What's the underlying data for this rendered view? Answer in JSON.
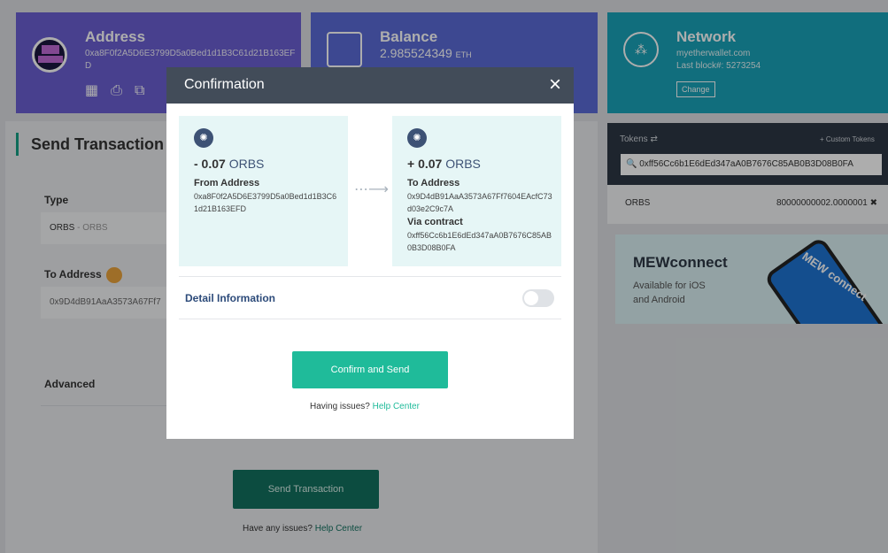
{
  "header": {
    "address": {
      "title": "Address",
      "value": "0xa8F0f2A5D6E3799D5a0Bed1d1B3C61d21B163EFD",
      "icons": [
        "qr-code-icon",
        "print-icon",
        "copy-icon"
      ]
    },
    "balance": {
      "title": "Balance",
      "value": "2.985524349",
      "unit": "ETH"
    },
    "network": {
      "title": "Network",
      "node": "myetherwallet.com",
      "last_block": "Last block#: 5273254",
      "change_label": "Change"
    }
  },
  "send": {
    "title": "Send Transaction",
    "type_label": "Type",
    "type_value": "ORBS",
    "type_value_sub": " - ORBS",
    "to_label": "To Address",
    "to_value": "0x9D4dB91AaA3573A67Ff7",
    "advanced_label": "Advanced",
    "send_button": "Send Transaction",
    "issues_text": "Have any issues?",
    "help_link": "Help Center"
  },
  "sidebar": {
    "tokens_label": "Tokens ⇄",
    "custom_tokens": "+ Custom Tokens",
    "search_value": "0xff56Cc6b1E6dEd347aA0B7676C85AB0B3D08B0FA",
    "token_name": "ORBS",
    "token_value": "80000000002.0000001",
    "mewconnect_title": "MEWconnect",
    "mewconnect_sub1": "Available for iOS",
    "mewconnect_sub2": "and Android",
    "mewconnect_phone_text": "MEW connect"
  },
  "modal": {
    "title": "Confirmation",
    "close": "×",
    "from_amount": "- 0.07",
    "to_amount": "+ 0.07",
    "token_unit": "ORBS",
    "from_label": "From Address",
    "from_value": "0xa8F0f2A5D6E3799D5a0Bed1d1B3C61d21B163EFD",
    "to_label": "To Address",
    "to_value": "0x9D4dB91AaA3573A67Ff7604EAcfC73d03e2C9c7A",
    "via_label": "Via contract",
    "via_value": "0xff56Cc6b1E6dEd347aA0B7676C85AB0B3D08B0FA",
    "detail_label": "Detail Information",
    "confirm_button": "Confirm and Send",
    "issues_text": "Having issues?",
    "help_link": "Help Center"
  }
}
